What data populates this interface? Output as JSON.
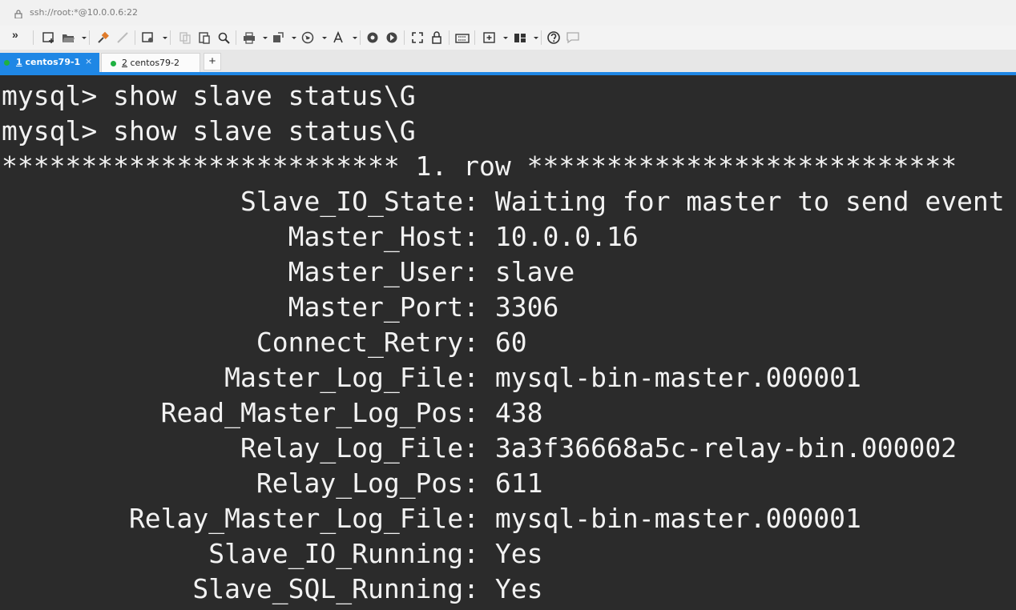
{
  "address_bar": {
    "url": "ssh://root:*@10.0.0.6:22"
  },
  "toolbar": {
    "overflow_label": "»",
    "icons": [
      "new-session-icon",
      "open-folder-icon",
      "connect-icon",
      "disconnect-icon",
      "properties-icon",
      "copy-icon",
      "paste-icon",
      "find-icon",
      "print-icon",
      "transfer-icon",
      "globe-icon",
      "font-icon",
      "script-record-icon",
      "script-run-icon",
      "fullscreen-icon",
      "lock-icon",
      "keyboard-icon",
      "add-icon",
      "layout-icon",
      "help-icon",
      "chat-icon"
    ]
  },
  "tabs": [
    {
      "num": "1",
      "name": " centos79-1",
      "close": "×",
      "active": true,
      "status_color": "#1fb141"
    },
    {
      "num": "2",
      "name": " centos79-2",
      "active": false,
      "status_color": "#1fb141"
    }
  ],
  "new_tab_label": "+",
  "colors": {
    "terminal_bg": "#2b2b2b",
    "terminal_fg": "#f2f2f2",
    "accent": "#1f87e5"
  },
  "terminal": {
    "lines": [
      "mysql> show slave status\\G",
      "mysql> show slave status\\G",
      "************************* 1. row ***************************",
      "               Slave_IO_State: Waiting for master to send event",
      "                  Master_Host: 10.0.0.16",
      "                  Master_User: slave",
      "                  Master_Port: 3306",
      "                Connect_Retry: 60",
      "              Master_Log_File: mysql-bin-master.000001",
      "          Read_Master_Log_Pos: 438",
      "               Relay_Log_File: 3a3f36668a5c-relay-bin.000002",
      "                Relay_Log_Pos: 611",
      "        Relay_Master_Log_File: mysql-bin-master.000001",
      "             Slave_IO_Running: Yes",
      "            Slave_SQL_Running: Yes"
    ]
  }
}
